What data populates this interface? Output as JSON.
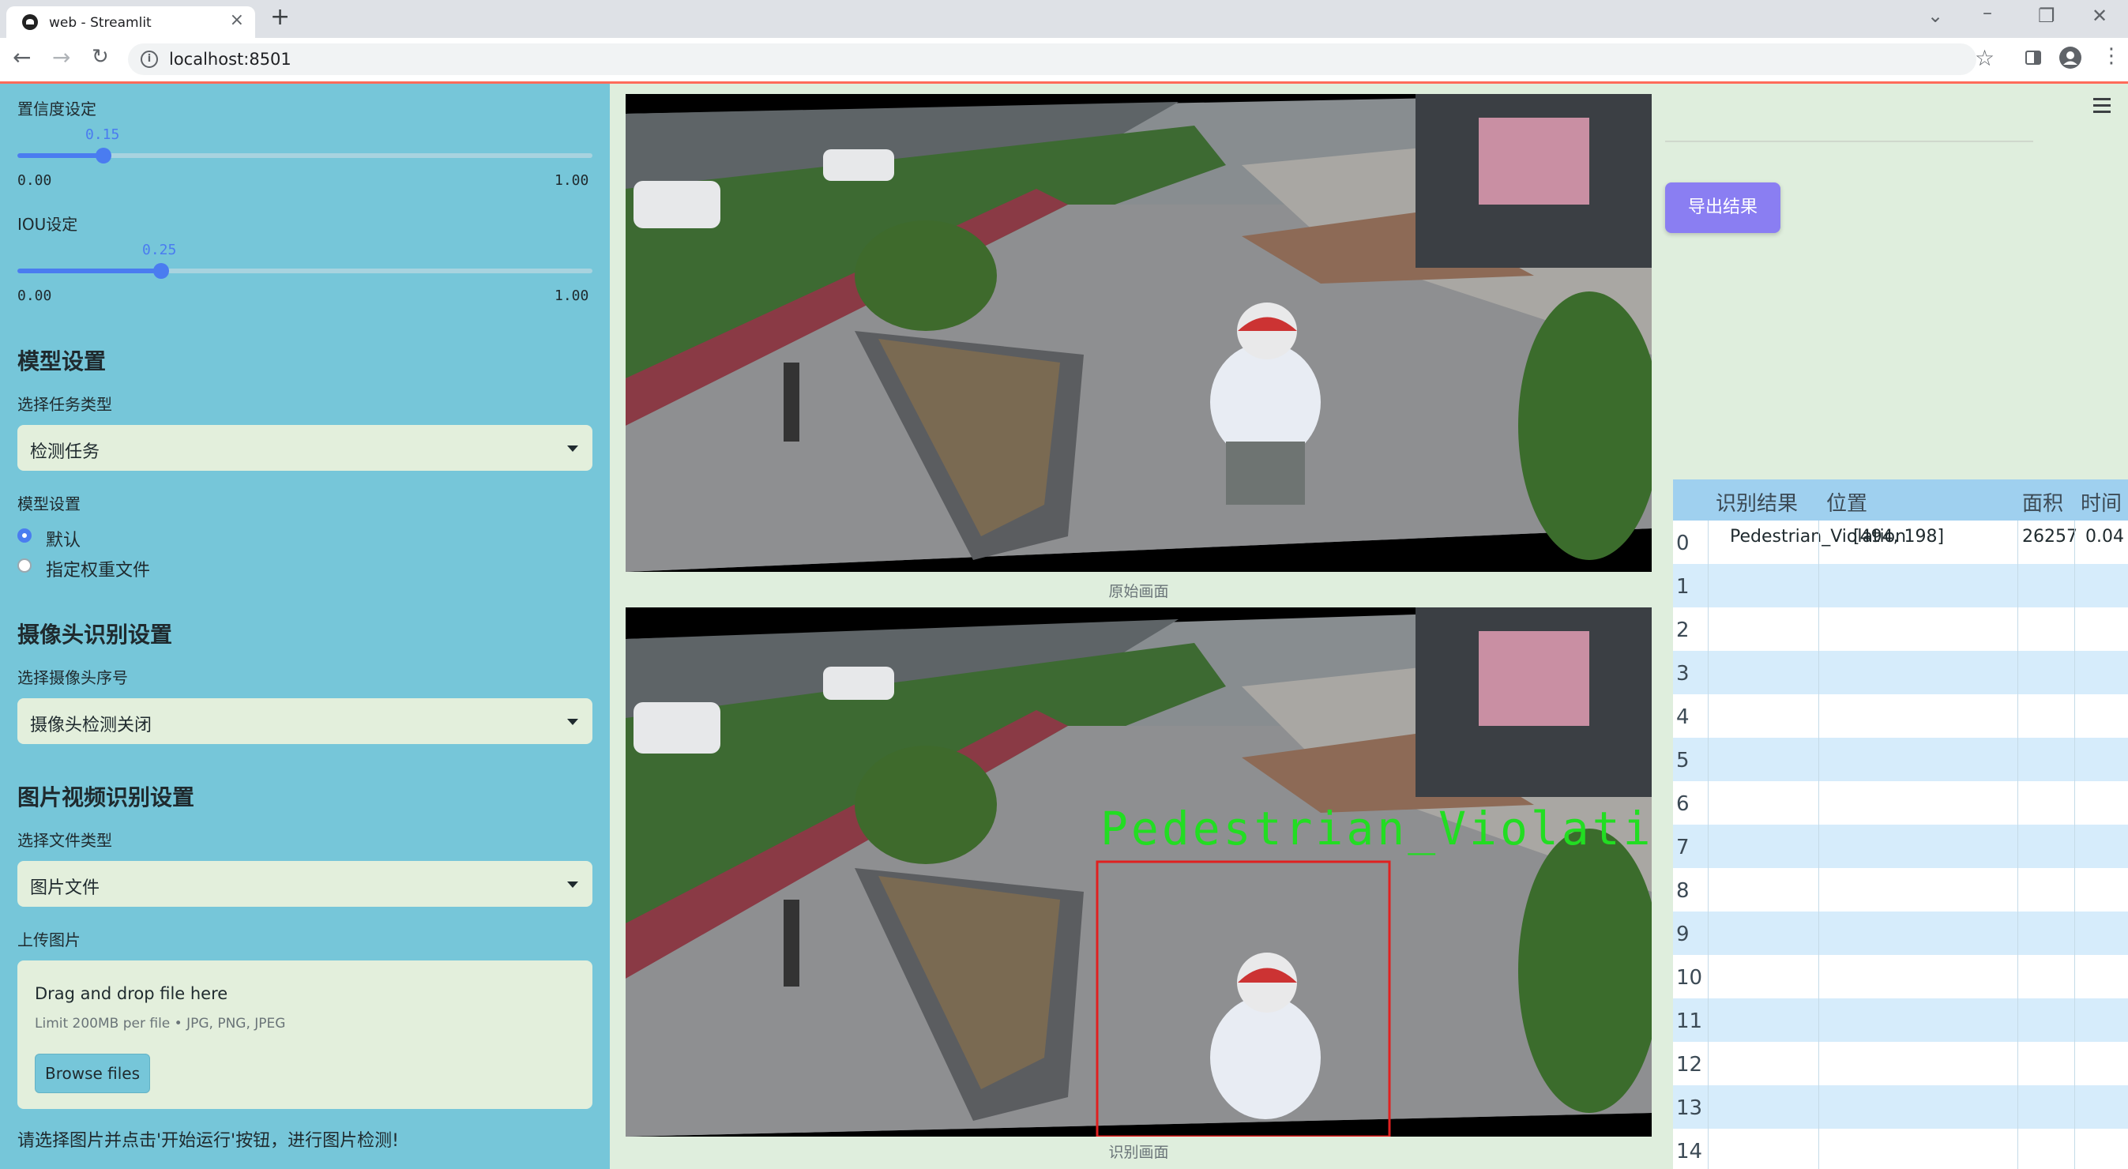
{
  "browser": {
    "tab_title": "web - Streamlit",
    "url": "localhost:8501"
  },
  "sidebar": {
    "confidence": {
      "label": "置信度设定",
      "value": "0.15",
      "value_fraction": 0.15,
      "min": "0.00",
      "max": "1.00"
    },
    "iou": {
      "label": "IOU设定",
      "value": "0.25",
      "value_fraction": 0.25,
      "min": "0.00",
      "max": "1.00"
    },
    "model_section": {
      "header": "模型设置",
      "task_label": "选择任务类型",
      "task_value": "检测任务",
      "weights_label": "模型设置",
      "weights_options": [
        "默认",
        "指定权重文件"
      ],
      "weights_selected": "默认"
    },
    "camera_section": {
      "header": "摄像头识别设置",
      "camera_label": "选择摄像头序号",
      "camera_value": "摄像头检测关闭"
    },
    "file_section": {
      "header": "图片视频识别设置",
      "type_label": "选择文件类型",
      "type_value": "图片文件",
      "upload_label": "上传图片",
      "dropzone_text": "Drag and drop file here",
      "dropzone_limit": "Limit 200MB per file • JPG, PNG, JPEG",
      "browse_label": "Browse files"
    },
    "hint": "请选择图片并点击'开始运行'按钮，进行图片检测!"
  },
  "main": {
    "original_caption": "原始画面",
    "result_caption": "识别画面",
    "detection_label": "Pedestrian_Violation",
    "export_label": "导出结果"
  },
  "results_table": {
    "columns": [
      "识别结果",
      "位置",
      "面积",
      "时间"
    ],
    "rows": [
      {
        "index": "0",
        "result": "Pedestrian_Violation",
        "position": "[494, 198]",
        "area": "26257",
        "time": "0.04"
      },
      {
        "index": "1"
      },
      {
        "index": "2"
      },
      {
        "index": "3"
      },
      {
        "index": "4"
      },
      {
        "index": "5"
      },
      {
        "index": "6"
      },
      {
        "index": "7"
      },
      {
        "index": "8"
      },
      {
        "index": "9"
      },
      {
        "index": "10"
      },
      {
        "index": "11"
      },
      {
        "index": "12"
      },
      {
        "index": "13"
      },
      {
        "index": "14"
      }
    ]
  },
  "colors": {
    "sidebar_bg": "#76c6d9",
    "main_bg": "#dfeedd",
    "accent": "#4a7cf0",
    "export_button": "#8a7ef2",
    "detection_box": "#e02020",
    "detection_text": "#22dd22"
  }
}
